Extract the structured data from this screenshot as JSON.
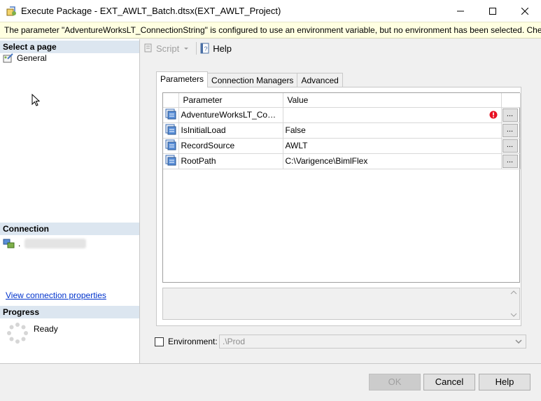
{
  "window": {
    "title": "Execute Package - EXT_AWLT_Batch.dtsx(EXT_AWLT_Project)",
    "controls": [
      "minimize",
      "maximize",
      "close"
    ]
  },
  "warning": {
    "text": "The parameter \"AdventureWorksLT_ConnectionString\" is configured to use an environment variable, but no environment has been selected.  Check the \"Envir..."
  },
  "left_panel": {
    "select_page_header": "Select a page",
    "pages": [
      {
        "label": "General",
        "icon": "page-icon"
      }
    ],
    "connection_header": "Connection",
    "connection_server": ".",
    "view_connection_link": "View connection properties",
    "progress_header": "Progress",
    "progress_status": "Ready"
  },
  "toolbar": {
    "script_label": "Script",
    "help_label": "Help"
  },
  "tabs": [
    "Parameters",
    "Connection Managers",
    "Advanced"
  ],
  "grid": {
    "columns": [
      "Parameter",
      "Value"
    ],
    "rows": [
      {
        "parameter": "AdventureWorksLT_Conne...",
        "value": "",
        "error": true
      },
      {
        "parameter": "IsInitialLoad",
        "value": "False",
        "error": false
      },
      {
        "parameter": "RecordSource",
        "value": "AWLT",
        "error": false
      },
      {
        "parameter": "RootPath",
        "value": "C:\\Varigence\\BimlFlex",
        "error": false
      }
    ],
    "ellipsis_label": "..."
  },
  "environment": {
    "label": "Environment:",
    "selected": ".\\Prod",
    "checked": false
  },
  "buttons": {
    "ok": "OK",
    "cancel": "Cancel",
    "help": "Help"
  }
}
